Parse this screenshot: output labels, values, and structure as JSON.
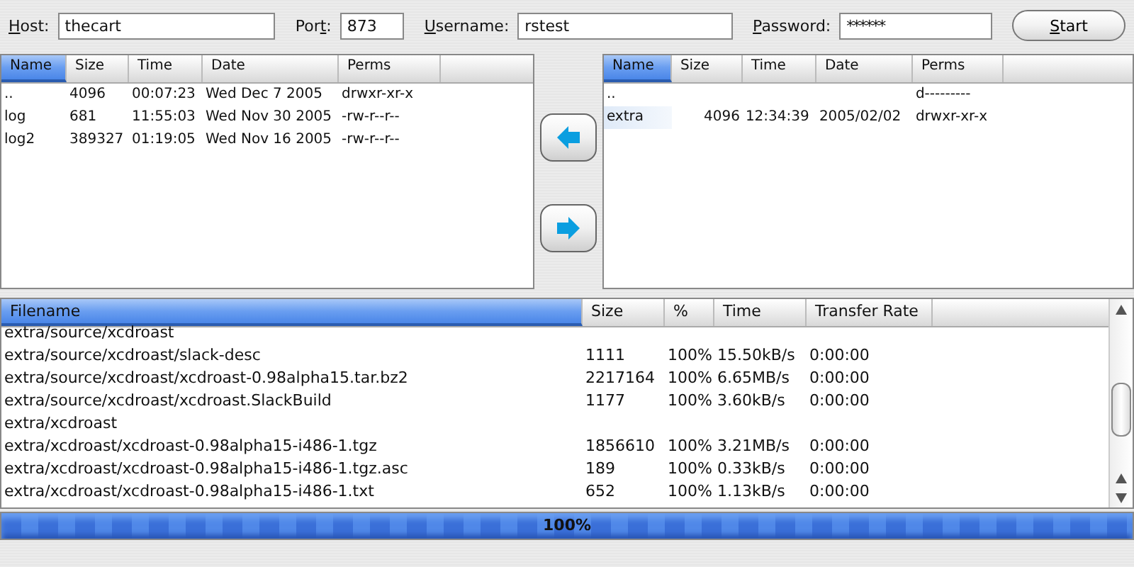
{
  "connection": {
    "fields": [
      {
        "label": {
          "key": "H",
          "after": "ost:"
        },
        "value": "thecart",
        "kind": "text"
      },
      {
        "label": {
          "before": "Por",
          "key": "t",
          "after": ":"
        },
        "value": "873",
        "kind": "text"
      },
      {
        "label": {
          "key": "U",
          "after": "sername:"
        },
        "value": "rstest",
        "kind": "text"
      },
      {
        "label": {
          "key": "P",
          "after": "assword:"
        },
        "value": "******",
        "kind": "password"
      }
    ],
    "button": {
      "key": "S",
      "after": "tart"
    }
  },
  "local_list": {
    "columns": [
      {
        "label": "Name",
        "selected": true
      },
      {
        "label": "Size",
        "selected": false
      },
      {
        "label": "Time",
        "selected": false
      },
      {
        "label": "Date",
        "selected": false
      },
      {
        "label": "Perms",
        "selected": false
      }
    ],
    "rows": [
      {
        "cells": [
          "..",
          "4096",
          "00:07:23",
          "Wed Dec 7 2005",
          "drwxr-xr-x"
        ],
        "selected": false
      },
      {
        "cells": [
          "log",
          "681",
          "11:55:03",
          "Wed Nov 30 2005",
          "-rw-r--r--"
        ],
        "selected": false
      },
      {
        "cells": [
          "log2",
          "389327",
          "01:19:05",
          "Wed Nov 16 2005",
          "-rw-r--r--"
        ],
        "selected": false
      }
    ]
  },
  "transfer_buttons": [
    {
      "kind": "left"
    },
    {
      "kind": "right"
    }
  ],
  "remote_list": {
    "columns": [
      {
        "label": "Name",
        "selected": true
      },
      {
        "label": "Size",
        "selected": false
      },
      {
        "label": "Time",
        "selected": false
      },
      {
        "label": "Date",
        "selected": false
      },
      {
        "label": "Perms",
        "selected": false
      }
    ],
    "rows": [
      {
        "cells": [
          "..",
          "",
          "",
          "",
          "d---------"
        ],
        "selected": false
      },
      {
        "cells": [
          "extra",
          "4096",
          "12:34:39",
          "2005/02/02",
          "drwxr-xr-x"
        ],
        "selected": true
      }
    ]
  },
  "queue": {
    "columns": [
      {
        "label": "Filename",
        "selected": true
      },
      {
        "label": "Size",
        "selected": false
      },
      {
        "label": "%",
        "selected": false
      },
      {
        "label": "Time",
        "selected": false
      },
      {
        "label": "Transfer Rate",
        "selected": false
      }
    ],
    "rows": [
      {
        "cells": [
          "extra/source/xcdroast",
          "",
          "",
          "",
          ""
        ]
      },
      {
        "cells": [
          "extra/source/xcdroast/slack-desc",
          "1111",
          "100%",
          "15.50kB/s",
          "0:00:00"
        ]
      },
      {
        "cells": [
          "extra/source/xcdroast/xcdroast-0.98alpha15.tar.bz2",
          "2217164",
          "100%",
          "6.65MB/s",
          "0:00:00"
        ]
      },
      {
        "cells": [
          "extra/source/xcdroast/xcdroast.SlackBuild",
          "1177",
          "100%",
          "3.60kB/s",
          "0:00:00"
        ]
      },
      {
        "cells": [
          "extra/xcdroast",
          "",
          "",
          "",
          ""
        ]
      },
      {
        "cells": [
          "extra/xcdroast/xcdroast-0.98alpha15-i486-1.tgz",
          "1856610",
          "100%",
          "3.21MB/s",
          "0:00:00"
        ]
      },
      {
        "cells": [
          "extra/xcdroast/xcdroast-0.98alpha15-i486-1.tgz.asc",
          "189",
          "100%",
          "0.33kB/s",
          "0:00:00"
        ]
      },
      {
        "cells": [
          "extra/xcdroast/xcdroast-0.98alpha15-i486-1.txt",
          "652",
          "100%",
          "1.13kB/s",
          "0:00:00"
        ]
      }
    ]
  },
  "progress": {
    "level": 1.0,
    "text": "100%"
  }
}
